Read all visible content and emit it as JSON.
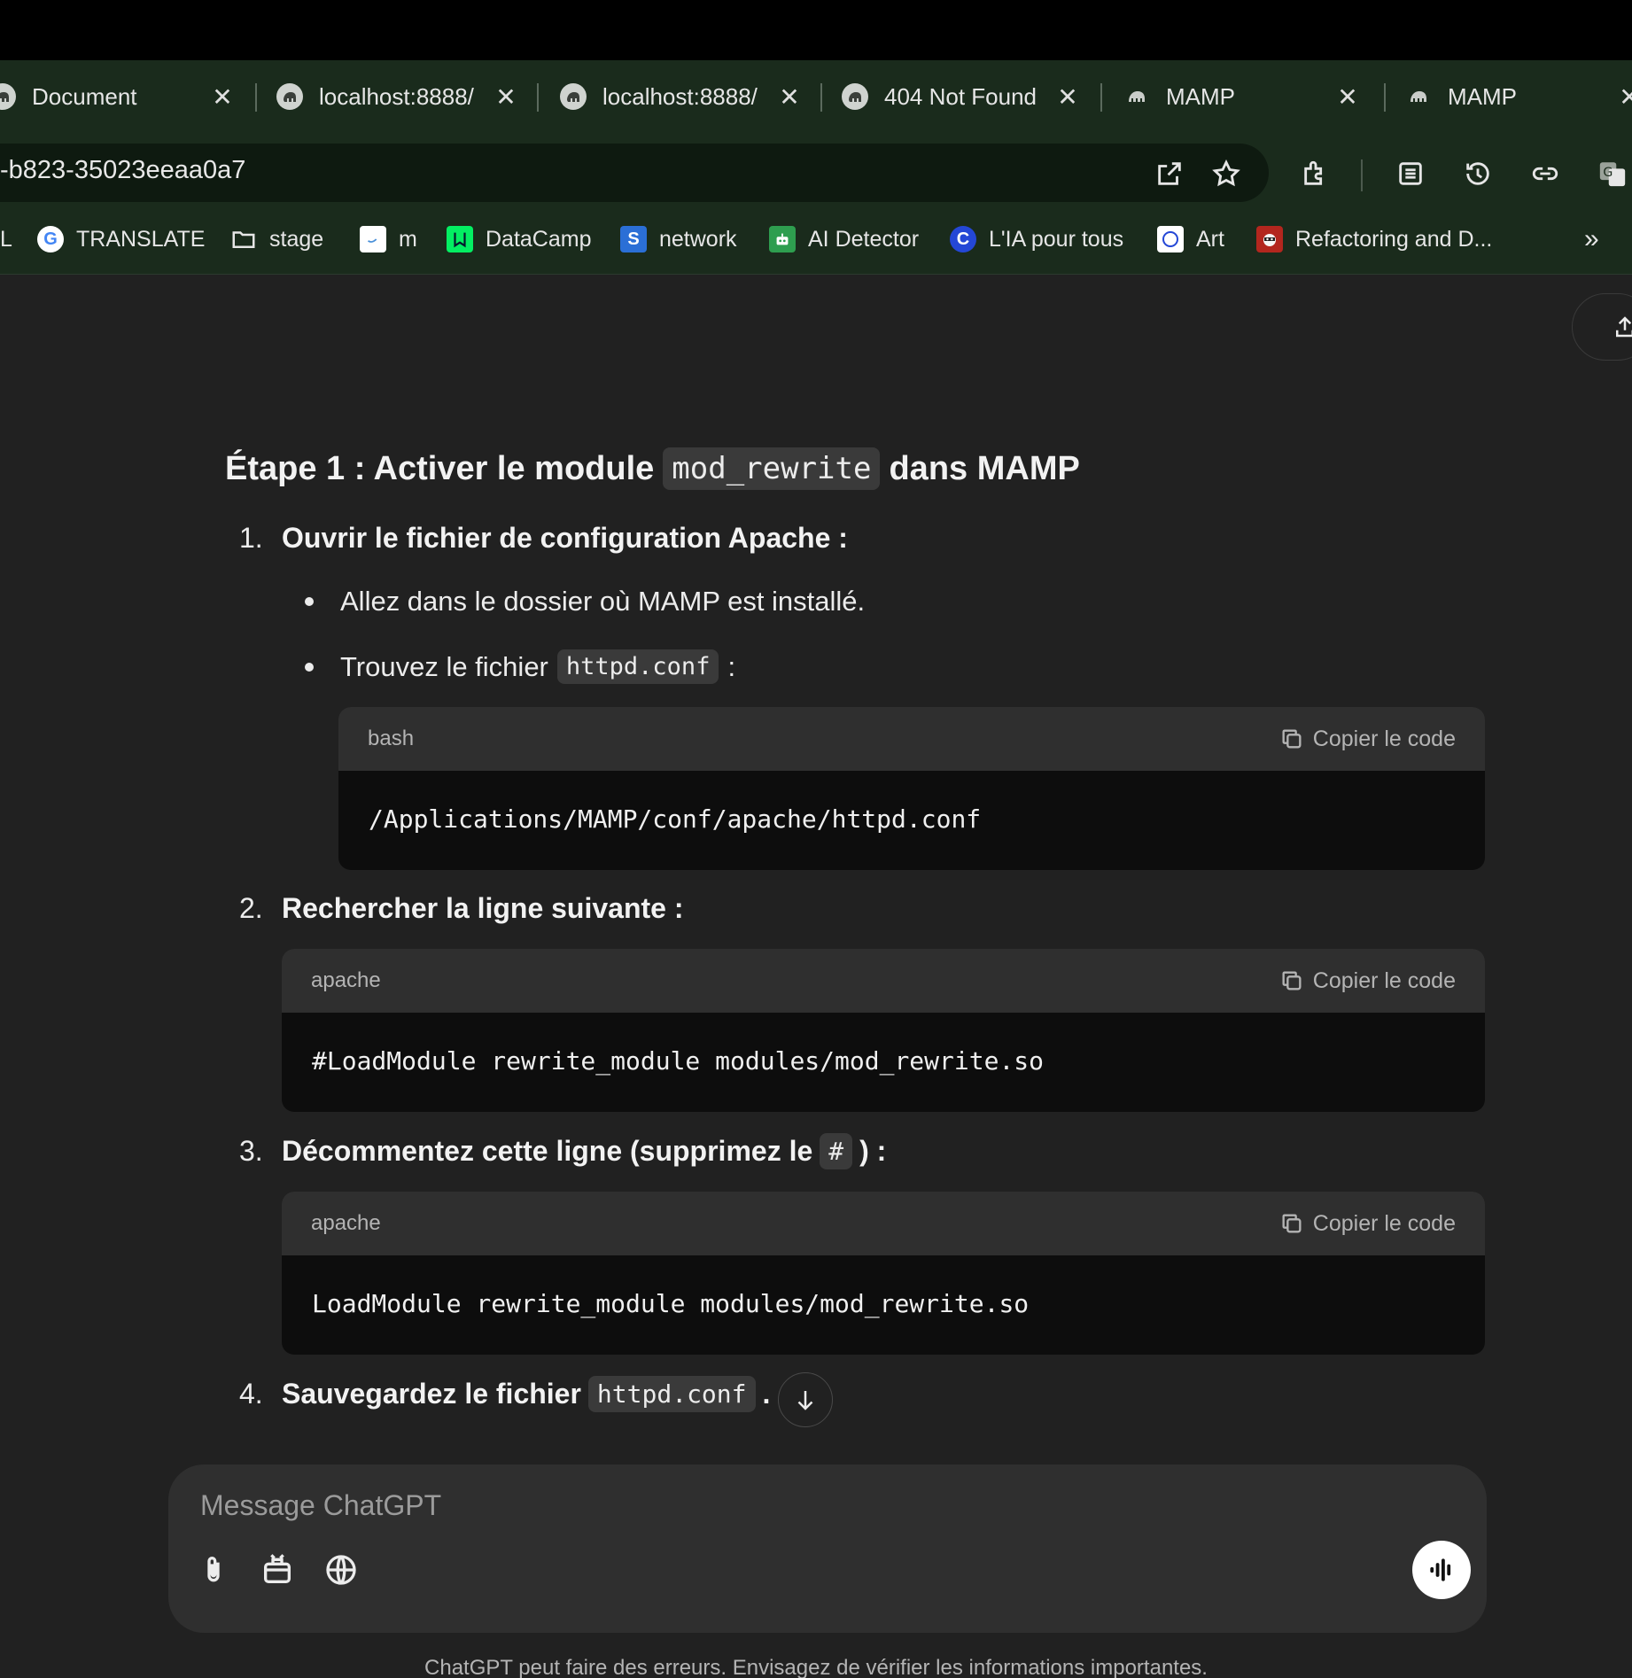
{
  "tabs": [
    {
      "title": "Document",
      "close": "✕"
    },
    {
      "title": "localhost:8888/",
      "close": "✕"
    },
    {
      "title": "localhost:8888/",
      "close": "✕"
    },
    {
      "title": "404 Not Found",
      "close": "✕"
    },
    {
      "title": "MAMP",
      "close": "✕"
    },
    {
      "title": "MAMP",
      "close": "✕"
    }
  ],
  "address_bar": {
    "url": "-b823-35023eeaa0a7"
  },
  "bookmarks": {
    "overflow": "»",
    "items": [
      {
        "label": "L"
      },
      {
        "label": "TRANSLATE",
        "icon": "G"
      },
      {
        "label": "stage"
      },
      {
        "label": "m"
      },
      {
        "label": "DataCamp"
      },
      {
        "label": "network",
        "icon": "S"
      },
      {
        "label": "AI Detector"
      },
      {
        "label": "L'IA pour tous",
        "icon": "C"
      },
      {
        "label": "Art"
      },
      {
        "label": "Refactoring and D..."
      }
    ]
  },
  "content": {
    "heading": {
      "pre": "Étape 1 : Activer le module",
      "code": "mod_rewrite",
      "post": "dans MAMP"
    },
    "items": [
      {
        "num": "1.",
        "head": "Ouvrir le fichier de configuration Apache :",
        "bullets": [
          {
            "text": "Allez dans le dossier où MAMP est installé."
          },
          {
            "pre": "Trouvez le fichier",
            "code": "httpd.conf",
            "post": ":"
          }
        ],
        "code": {
          "lang": "bash",
          "copy": "Copier le code",
          "text": "/Applications/MAMP/conf/apache/httpd.conf"
        }
      },
      {
        "num": "2.",
        "head": "Rechercher la ligne suivante :",
        "code": {
          "lang": "apache",
          "copy": "Copier le code",
          "text": "#LoadModule rewrite_module modules/mod_rewrite.so"
        }
      },
      {
        "num": "3.",
        "head_pre": "Décommentez cette ligne (supprimez le",
        "head_code": "#",
        "head_post": ") :",
        "code": {
          "lang": "apache",
          "copy": "Copier le code",
          "text": "LoadModule rewrite_module modules/mod_rewrite.so"
        }
      },
      {
        "num": "4.",
        "head_pre": "Sauvegardez le fichier",
        "head_code": "httpd.conf",
        "head_post": "."
      }
    ]
  },
  "composer": {
    "placeholder": "Message ChatGPT"
  },
  "disclaimer": "ChatGPT peut faire des erreurs. Envisagez de vérifier les informations importantes.",
  "colors": {
    "chrome": "#1a2b1c",
    "page": "#212121",
    "code_bg": "#0d0d0d",
    "code_head": "#2f2f2f"
  }
}
